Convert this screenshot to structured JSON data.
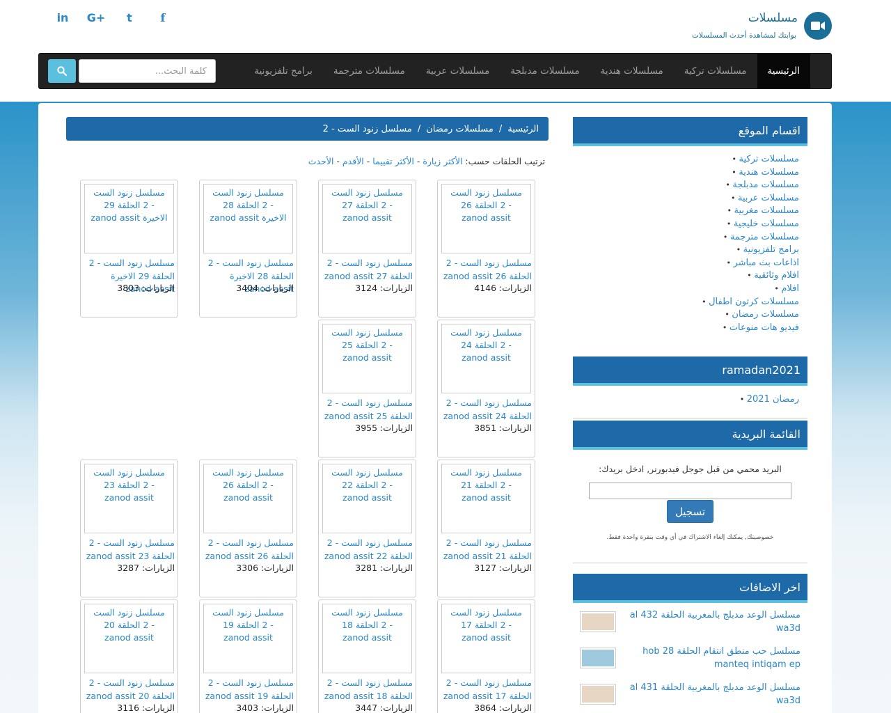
{
  "site": {
    "title": "مسلسلات",
    "tagline": "بوابتك لمشاهدة أحدث المسلسلات",
    "icon": "video-camera-icon",
    "social": [
      {
        "name": "linkedin-icon",
        "glyph": "in"
      },
      {
        "name": "google-plus-icon",
        "glyph": "G+"
      },
      {
        "name": "twitter-icon",
        "glyph": "t"
      },
      {
        "name": "facebook-icon",
        "glyph": "f"
      }
    ]
  },
  "nav": {
    "items": [
      "الرئيسية",
      "مسلسلات تركية",
      "مسلسلات هندية",
      "مسلسلات مدبلجة",
      "مسلسلات عربية",
      "مسلسلات مترجمة",
      "برامج تلفزيونية"
    ],
    "search_placeholder": "كلمة البحث..."
  },
  "breadcrumb": [
    "الرئيسية",
    "مسلسلات رمضان",
    "مسلسل زنود الست - 2"
  ],
  "sort": {
    "label": "ترتيب الحلقات حسب:",
    "options": [
      "الأكثر زيارة",
      "الأكثر تقييما",
      "الأقدم",
      "الأحدث"
    ],
    "separator": " - "
  },
  "episodes": [
    {
      "thumb": "مسلسل زنود الست - 2 الحلقة 26 zanod assit",
      "title": "مسلسل زنود الست - 2 الحلقة 26 zanod assit",
      "views": "الزيارات: 4146"
    },
    {
      "thumb": "مسلسل زنود الست - 2 الحلقة 27 zanod assit",
      "title": "مسلسل زنود الست - 2 الحلقة 27 zanod assit",
      "views": "الزيارات: 3124"
    },
    {
      "thumb": "مسلسل زنود الست - 2 الحلقة 28 الاخيرة zanod assit",
      "title": "مسلسل زنود الست - 2 الحلقة 28 الاخيرة zanod assit",
      "views": "الزيارات: 3404"
    },
    {
      "thumb": "مسلسل زنود الست - 2 الحلقة 29 الاخيرة zanod assit",
      "title": "مسلسل زنود الست - 2 الحلقة 29 الاخيرة zanod assit",
      "views": "الزيارات: 3803"
    },
    {
      "thumb": "مسلسل زنود الست - 2 الحلقة 24 zanod assit",
      "title": "مسلسل زنود الست - 2 الحلقة 24 zanod assit",
      "views": "الزيارات: 3851"
    },
    {
      "thumb": "مسلسل زنود الست - 2 الحلقة 25 zanod assit",
      "title": "مسلسل زنود الست - 2 الحلقة 25 zanod assit",
      "views": "الزيارات: 3955"
    },
    {
      "thumb": "مسلسل زنود الست - 2 الحلقة 21 zanod assit",
      "title": "مسلسل زنود الست - 2 الحلقة 21 zanod assit",
      "views": "الزيارات: 3127"
    },
    {
      "thumb": "مسلسل زنود الست - 2 الحلقة 22 zanod assit",
      "title": "مسلسل زنود الست - 2 الحلقة 22 zanod assit",
      "views": "الزيارات: 3281"
    },
    {
      "thumb": "مسلسل زنود الست - 2 الحلقة 26 zanod assit",
      "title": "مسلسل زنود الست - 2 الحلقة 26 zanod assit",
      "views": "الزيارات: 3306"
    },
    {
      "thumb": "مسلسل زنود الست - 2 الحلقة 23 zanod assit",
      "title": "مسلسل زنود الست - 2 الحلقة 23 zanod assit",
      "views": "الزيارات: 3287"
    },
    {
      "thumb": "مسلسل زنود الست - 2 الحلقة 17 zanod assit",
      "title": "مسلسل زنود الست - 2 الحلقة 17 zanod assit",
      "views": "الزيارات: 3864"
    },
    {
      "thumb": "مسلسل زنود الست - 2 الحلقة 18 zanod assit",
      "title": "مسلسل زنود الست - 2 الحلقة 18 zanod assit",
      "views": "الزيارات: 3447"
    },
    {
      "thumb": "مسلسل زنود الست - 2 الحلقة 19 zanod assit",
      "title": "مسلسل زنود الست - 2 الحلقة 19 zanod assit",
      "views": "الزيارات: 3403"
    },
    {
      "thumb": "مسلسل زنود الست - 2 الحلقة 20 zanod assit",
      "title": "مسلسل زنود الست - 2 الحلقة 20 zanod assit",
      "views": "الزيارات: 3116"
    }
  ],
  "sidebar": {
    "categories_title": "اقسام الموقع",
    "categories": [
      "مسلسلات تركية",
      "مسلسلات هندية",
      "مسلسلات مدبلجة",
      "مسلسلات عربية",
      "مسلسلات مغربية",
      "مسلسلات خليجية",
      "مسلسلات مترجمة",
      "برامج تلفزيونية",
      "اذاعات بث مباشر",
      "افلام وثائقية",
      "افلام",
      "مسلسلات كرتون اطفال",
      "مسلسلات رمضان",
      "فيديو هات منوعات"
    ],
    "ramadan_title": "ramadan2021",
    "ramadan_items": [
      "رمضان 2021"
    ],
    "mail_title": "القائمة البريدية",
    "mail_text": "البريد محمي من قبل جوجل فيدبورنر, ادخل بريدك:",
    "mail_button": "تسجيل",
    "mail_note": "خصوصيتك, يمكنك إلغاء الاشتراك في أي وقت بنقرة واحدة فقط.",
    "recent_title": "اخر الاضافات",
    "recent": [
      {
        "text": "مسلسل الوعد مدبلج بالمغربية الحلقة 432 al wa3d",
        "thumb_color": "#e8d6c4"
      },
      {
        "text": "مسلسل حب منطق انتقام الحلقة 28 hob manteq intiqam ep",
        "thumb_color": "#9fc9dc"
      },
      {
        "text": "مسلسل الوعد مدبلج بالمغربية الحلقة 431 al wa3d",
        "thumb_color": "#e8d6c4"
      }
    ]
  }
}
